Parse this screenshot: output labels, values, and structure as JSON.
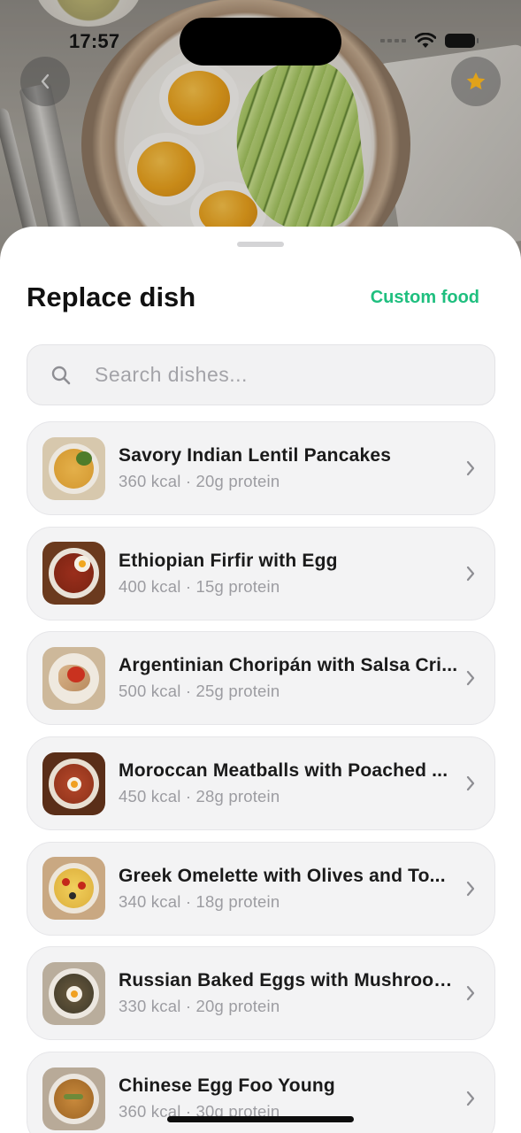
{
  "status_bar": {
    "time": "17:57"
  },
  "header": {
    "back_icon": "chevron-left-icon",
    "favorite_icon": "star-icon",
    "favorite_color": "#e0a21a"
  },
  "sheet": {
    "title": "Replace dish",
    "custom_food_label": "Custom food",
    "accent_color": "#1fbf7f"
  },
  "search": {
    "placeholder": "Search dishes...",
    "value": ""
  },
  "dishes": [
    {
      "name": "Savory Indian Lentil Pancakes",
      "meta": "360 kcal · 20g protein"
    },
    {
      "name": "Ethiopian Firfir with Egg",
      "meta": "400 kcal · 15g protein"
    },
    {
      "name": "Argentinian Choripán with Salsa Cri...",
      "meta": "500 kcal · 25g protein"
    },
    {
      "name": "Moroccan Meatballs with Poached ...",
      "meta": "450 kcal · 28g protein"
    },
    {
      "name": "Greek Omelette with Olives and To...",
      "meta": "340 kcal · 18g protein"
    },
    {
      "name": "Russian Baked Eggs with Mushrooms",
      "meta": "330 kcal · 20g protein"
    },
    {
      "name": "Chinese Egg Foo Young",
      "meta": "360 kcal · 30g protein"
    }
  ]
}
